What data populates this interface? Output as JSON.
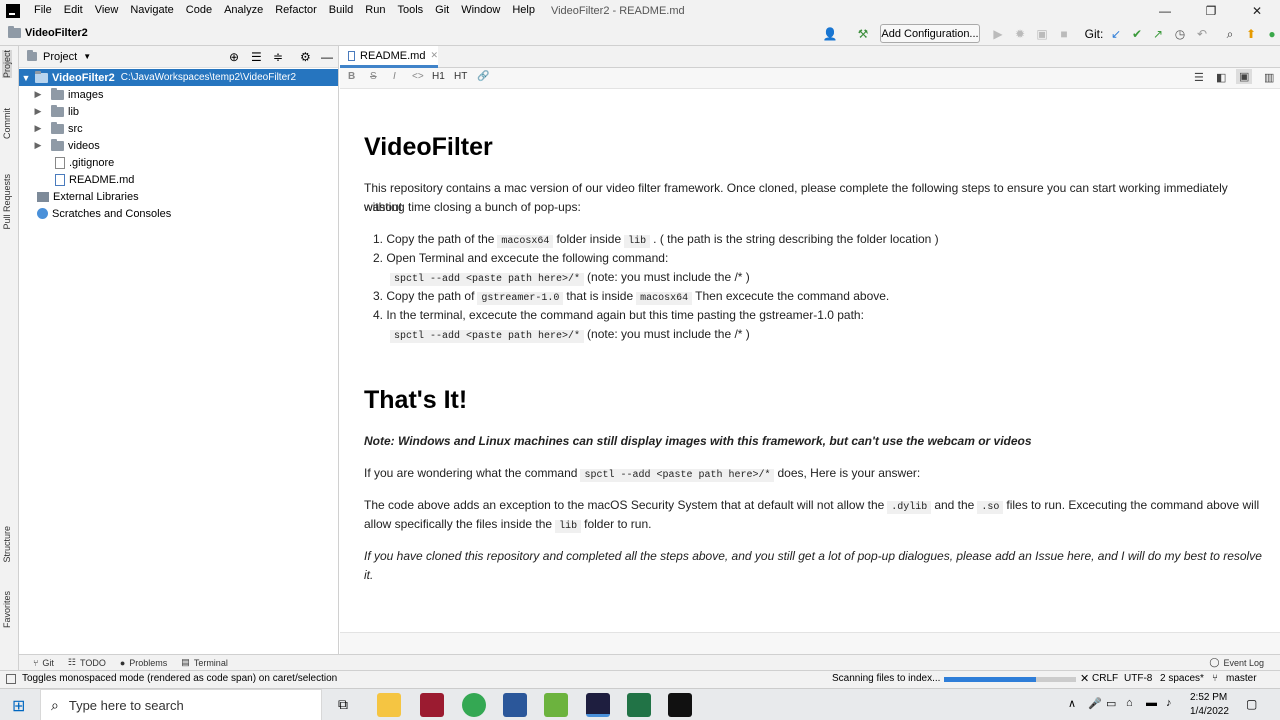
{
  "menubar": {
    "items": [
      "File",
      "Edit",
      "View",
      "Navigate",
      "Code",
      "Analyze",
      "Refactor",
      "Build",
      "Run",
      "Tools",
      "Git",
      "Window",
      "Help"
    ],
    "title": "VideoFilter2 - README.md"
  },
  "navbar": {
    "project": "VideoFilter2",
    "add_config": "Add Configuration...",
    "git_label": "Git:"
  },
  "left_strip": {
    "project": "Project",
    "commit": "Commit",
    "pull_requests": "Pull Requests",
    "structure": "Structure",
    "favorites": "Favorites"
  },
  "project_panel": {
    "title": "Project",
    "tree": [
      {
        "label": "VideoFilter2",
        "path": "C:\\JavaWorkspaces\\temp2\\VideoFilter2"
      },
      {
        "label": "images"
      },
      {
        "label": "lib"
      },
      {
        "label": "src"
      },
      {
        "label": "videos"
      },
      {
        "label": ".gitignore"
      },
      {
        "label": "README.md"
      },
      {
        "label": "External Libraries"
      },
      {
        "label": "Scratches and Consoles"
      }
    ]
  },
  "editor": {
    "tab": "README.md",
    "toolbar": [
      "B",
      "S",
      "I",
      "<>",
      "H1",
      "HT",
      "link"
    ]
  },
  "doc": {
    "h1_a": "VideoFilter",
    "intro_1": "This repository contains a mac version of our video filter framework. Once cloned, please complete the following steps to ensure you can start working immediately without",
    "intro_2": "wasting time closing a bunch of pop-ups:",
    "s1_a": "1. Copy the path of the",
    "s1_code1": "macosx64",
    "s1_b": "folder inside",
    "s1_code2": "lib",
    "s1_c": ". ( the path is the string describing the folder location )",
    "s2_a": "2. Open Terminal and excecute the following command:",
    "s2_code": "spctl --add <paste path here>/*",
    "s2_note": "(note: you must include the /* )",
    "s3_a": "3. Copy the path of",
    "s3_code1": "gstreamer-1.0",
    "s3_b": "that is inside",
    "s3_code2": "macosx64",
    "s3_c": "Then excecute the command above.",
    "s4_a": "4. In the terminal, excecute the command again but this time pasting the gstreamer-1.0 path:",
    "s4_code": "spctl --add <paste path here>/*",
    "s4_note": "(note: you must include the /* )",
    "h1_b": "That's It!",
    "note": "Note: Windows and Linux machines can still display images with this framework, but can't use the webcam or videos",
    "q_a": "If you are wondering what the command",
    "q_code": "spctl --add <paste path here>/*",
    "q_b": "does, Here is your answer:",
    "ans_a": "The code above adds an exception to the macOS Security System that at default will not allow the",
    "ans_code1": ".dylib",
    "ans_b": "and the",
    "ans_code2": ".so",
    "ans_c": "files to run. Excecuting the command above will",
    "ans2_a": "allow specifically the files inside the",
    "ans2_code": "lib",
    "ans2_b": "folder to run.",
    "closing": "If you have cloned this repository and completed all the steps above, and you still get a lot of pop-up dialogues, please add an Issue here, and I will do my best to resolve it."
  },
  "toolwindows": {
    "git": "Git",
    "todo": "TODO",
    "problems": "Problems",
    "terminal": "Terminal",
    "event_log": "Event Log"
  },
  "status": {
    "message": "Toggles monospaced mode (rendered as code span) on caret/selection",
    "indexing": "Scanning files to index...",
    "indexing_progress": 0.7,
    "line_sep": "CRLF",
    "encoding": "UTF-8",
    "indent": "2 spaces*",
    "branch": "master"
  },
  "taskbar": {
    "search": "Type here to search",
    "time": "2:52 PM",
    "date": "1/4/2022"
  }
}
